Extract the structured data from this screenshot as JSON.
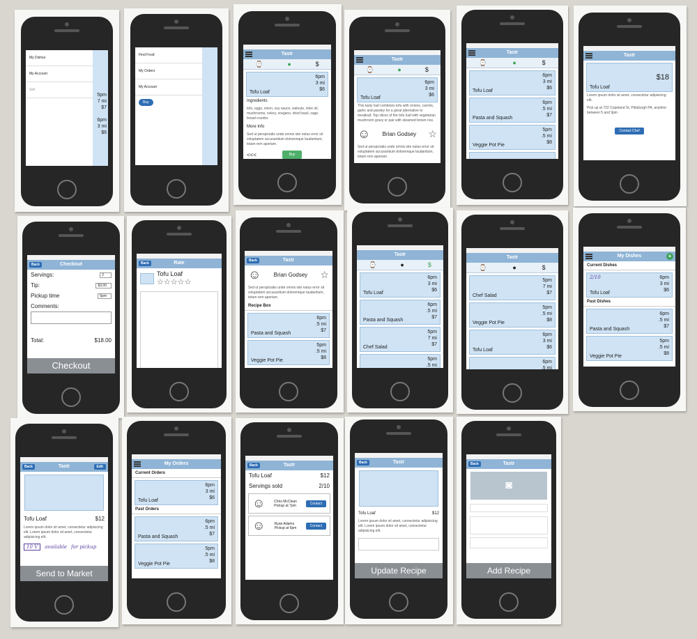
{
  "colors": {
    "nav": "#8fb4d6",
    "card": "#cfe3f4",
    "buy": "#4fb06b",
    "action": "#2e6db4",
    "bigbar": "#8a8f94"
  },
  "icons": {
    "menu": "hamburger-icon",
    "watch": "watch-icon",
    "location": "location-pin-icon",
    "money": "money-icon",
    "star": "star-icon",
    "person": "person-icon",
    "camera": "camera-icon",
    "plus": "plus-icon"
  },
  "common": {
    "tastr": "Tastr",
    "back": "Back",
    "buy": "Buy",
    "tofu_loaf": "Tofu Loaf",
    "pasta": "Pasta and Squash",
    "veggie": "Veggie Pot Pie",
    "chef_salad": "Chef Salad",
    "t6pm": "6pm",
    "t5pm": "5pm",
    "d3": "3 mi",
    "d5": ".5 mi",
    "d7": "7 mi",
    "p6": "$6",
    "p7": "$7",
    "p8": "$8",
    "p12": "$12",
    "p18": "$18",
    "brian": "Brian Godsey",
    "lorem": "Sed ut perspiciatis unde omnis iste natus error sit voluptatem accusantium doloremque laudantium, totam rem aperiam.",
    "lorem2": "Lorem ipsum dolor sit amet, consectetur adipisicing elit. Lorem ipsum dolor sit amet, consectetur adipisicing elit."
  },
  "menu1": {
    "items": [
      "My Dishes",
      "My Account",
      "Sell"
    ]
  },
  "menu2": {
    "items": [
      "Find Food",
      "My Orders",
      "My Account"
    ],
    "toggle": "Buy"
  },
  "detail": {
    "ingredients": "Ingredients",
    "ingredients_text": "tofu, eggs, onion, soy sauce, walnuts, olive oil, mushrooms, celery, oregano, dried basil, sage, bread crumbs",
    "more_info": "More Info",
    "prev": "<<<",
    "next": ">>>"
  },
  "chef_detail": {
    "desc": "This tasty loaf combines tofu with onions, carrots, garlic and parsley for a great alternative to meatloaf. Top slices of the tofu loaf with vegetarian mushroom gravy or pair with steamed brown rice."
  },
  "contact": {
    "desc": "Lorem ipsum dolor sit amet, consectetur adipisicing elit.",
    "pickup": "Pick up at 722 Copeland St, Pittsburgh PA, anytime between 5 and 9pm",
    "button": "Contact Chef"
  },
  "checkout": {
    "title": "Checkout",
    "servings": "Servings:",
    "servings_val": "2",
    "tip": "Tip:",
    "tip_val": "$3.00",
    "pickup": "Pickup time",
    "pickup_val": "6pm",
    "comments": "Comments:",
    "total": "Total:",
    "total_val": "$18.00",
    "button": "Checkout"
  },
  "rate": {
    "title": "Rate"
  },
  "profile": {
    "recipe_box": "Recipe Box"
  },
  "my_dishes": {
    "title": "My Dishes",
    "current": "Current Dishes",
    "past": "Past Dishes",
    "note": "2/10"
  },
  "market": {
    "edit": "Edit",
    "qty": "10 V",
    "note1": "available",
    "note2": "for pickup",
    "button": "Send to Market"
  },
  "my_orders": {
    "title": "My Orders",
    "current": "Current Orders",
    "past": "Past Orders"
  },
  "servings": {
    "label": "Servings sold",
    "sold": "2/10",
    "buyers": [
      {
        "name": "Chris McClean",
        "time": "Pickup at 7pm"
      },
      {
        "name": "Ryan Adams",
        "time": "Pickup at 6pm"
      }
    ],
    "contact": "Contact"
  },
  "update": {
    "button": "Update Recipe"
  },
  "add": {
    "button": "Add Recipe"
  }
}
